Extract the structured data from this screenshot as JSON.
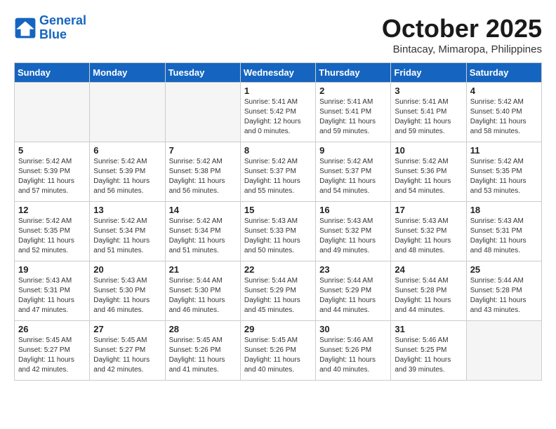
{
  "header": {
    "logo_line1": "General",
    "logo_line2": "Blue",
    "month_title": "October 2025",
    "subtitle": "Bintacay, Mimaropa, Philippines"
  },
  "weekdays": [
    "Sunday",
    "Monday",
    "Tuesday",
    "Wednesday",
    "Thursday",
    "Friday",
    "Saturday"
  ],
  "weeks": [
    [
      {
        "day": "",
        "empty": true
      },
      {
        "day": "",
        "empty": true
      },
      {
        "day": "",
        "empty": true
      },
      {
        "day": "1",
        "sunrise": "Sunrise: 5:41 AM",
        "sunset": "Sunset: 5:42 PM",
        "daylight": "Daylight: 12 hours and 0 minutes."
      },
      {
        "day": "2",
        "sunrise": "Sunrise: 5:41 AM",
        "sunset": "Sunset: 5:41 PM",
        "daylight": "Daylight: 11 hours and 59 minutes."
      },
      {
        "day": "3",
        "sunrise": "Sunrise: 5:41 AM",
        "sunset": "Sunset: 5:41 PM",
        "daylight": "Daylight: 11 hours and 59 minutes."
      },
      {
        "day": "4",
        "sunrise": "Sunrise: 5:42 AM",
        "sunset": "Sunset: 5:40 PM",
        "daylight": "Daylight: 11 hours and 58 minutes."
      }
    ],
    [
      {
        "day": "5",
        "sunrise": "Sunrise: 5:42 AM",
        "sunset": "Sunset: 5:39 PM",
        "daylight": "Daylight: 11 hours and 57 minutes."
      },
      {
        "day": "6",
        "sunrise": "Sunrise: 5:42 AM",
        "sunset": "Sunset: 5:39 PM",
        "daylight": "Daylight: 11 hours and 56 minutes."
      },
      {
        "day": "7",
        "sunrise": "Sunrise: 5:42 AM",
        "sunset": "Sunset: 5:38 PM",
        "daylight": "Daylight: 11 hours and 56 minutes."
      },
      {
        "day": "8",
        "sunrise": "Sunrise: 5:42 AM",
        "sunset": "Sunset: 5:37 PM",
        "daylight": "Daylight: 11 hours and 55 minutes."
      },
      {
        "day": "9",
        "sunrise": "Sunrise: 5:42 AM",
        "sunset": "Sunset: 5:37 PM",
        "daylight": "Daylight: 11 hours and 54 minutes."
      },
      {
        "day": "10",
        "sunrise": "Sunrise: 5:42 AM",
        "sunset": "Sunset: 5:36 PM",
        "daylight": "Daylight: 11 hours and 54 minutes."
      },
      {
        "day": "11",
        "sunrise": "Sunrise: 5:42 AM",
        "sunset": "Sunset: 5:35 PM",
        "daylight": "Daylight: 11 hours and 53 minutes."
      }
    ],
    [
      {
        "day": "12",
        "sunrise": "Sunrise: 5:42 AM",
        "sunset": "Sunset: 5:35 PM",
        "daylight": "Daylight: 11 hours and 52 minutes."
      },
      {
        "day": "13",
        "sunrise": "Sunrise: 5:42 AM",
        "sunset": "Sunset: 5:34 PM",
        "daylight": "Daylight: 11 hours and 51 minutes."
      },
      {
        "day": "14",
        "sunrise": "Sunrise: 5:42 AM",
        "sunset": "Sunset: 5:34 PM",
        "daylight": "Daylight: 11 hours and 51 minutes."
      },
      {
        "day": "15",
        "sunrise": "Sunrise: 5:43 AM",
        "sunset": "Sunset: 5:33 PM",
        "daylight": "Daylight: 11 hours and 50 minutes."
      },
      {
        "day": "16",
        "sunrise": "Sunrise: 5:43 AM",
        "sunset": "Sunset: 5:32 PM",
        "daylight": "Daylight: 11 hours and 49 minutes."
      },
      {
        "day": "17",
        "sunrise": "Sunrise: 5:43 AM",
        "sunset": "Sunset: 5:32 PM",
        "daylight": "Daylight: 11 hours and 48 minutes."
      },
      {
        "day": "18",
        "sunrise": "Sunrise: 5:43 AM",
        "sunset": "Sunset: 5:31 PM",
        "daylight": "Daylight: 11 hours and 48 minutes."
      }
    ],
    [
      {
        "day": "19",
        "sunrise": "Sunrise: 5:43 AM",
        "sunset": "Sunset: 5:31 PM",
        "daylight": "Daylight: 11 hours and 47 minutes."
      },
      {
        "day": "20",
        "sunrise": "Sunrise: 5:43 AM",
        "sunset": "Sunset: 5:30 PM",
        "daylight": "Daylight: 11 hours and 46 minutes."
      },
      {
        "day": "21",
        "sunrise": "Sunrise: 5:44 AM",
        "sunset": "Sunset: 5:30 PM",
        "daylight": "Daylight: 11 hours and 46 minutes."
      },
      {
        "day": "22",
        "sunrise": "Sunrise: 5:44 AM",
        "sunset": "Sunset: 5:29 PM",
        "daylight": "Daylight: 11 hours and 45 minutes."
      },
      {
        "day": "23",
        "sunrise": "Sunrise: 5:44 AM",
        "sunset": "Sunset: 5:29 PM",
        "daylight": "Daylight: 11 hours and 44 minutes."
      },
      {
        "day": "24",
        "sunrise": "Sunrise: 5:44 AM",
        "sunset": "Sunset: 5:28 PM",
        "daylight": "Daylight: 11 hours and 44 minutes."
      },
      {
        "day": "25",
        "sunrise": "Sunrise: 5:44 AM",
        "sunset": "Sunset: 5:28 PM",
        "daylight": "Daylight: 11 hours and 43 minutes."
      }
    ],
    [
      {
        "day": "26",
        "sunrise": "Sunrise: 5:45 AM",
        "sunset": "Sunset: 5:27 PM",
        "daylight": "Daylight: 11 hours and 42 minutes."
      },
      {
        "day": "27",
        "sunrise": "Sunrise: 5:45 AM",
        "sunset": "Sunset: 5:27 PM",
        "daylight": "Daylight: 11 hours and 42 minutes."
      },
      {
        "day": "28",
        "sunrise": "Sunrise: 5:45 AM",
        "sunset": "Sunset: 5:26 PM",
        "daylight": "Daylight: 11 hours and 41 minutes."
      },
      {
        "day": "29",
        "sunrise": "Sunrise: 5:45 AM",
        "sunset": "Sunset: 5:26 PM",
        "daylight": "Daylight: 11 hours and 40 minutes."
      },
      {
        "day": "30",
        "sunrise": "Sunrise: 5:46 AM",
        "sunset": "Sunset: 5:26 PM",
        "daylight": "Daylight: 11 hours and 40 minutes."
      },
      {
        "day": "31",
        "sunrise": "Sunrise: 5:46 AM",
        "sunset": "Sunset: 5:25 PM",
        "daylight": "Daylight: 11 hours and 39 minutes."
      },
      {
        "day": "",
        "empty": true
      }
    ]
  ]
}
